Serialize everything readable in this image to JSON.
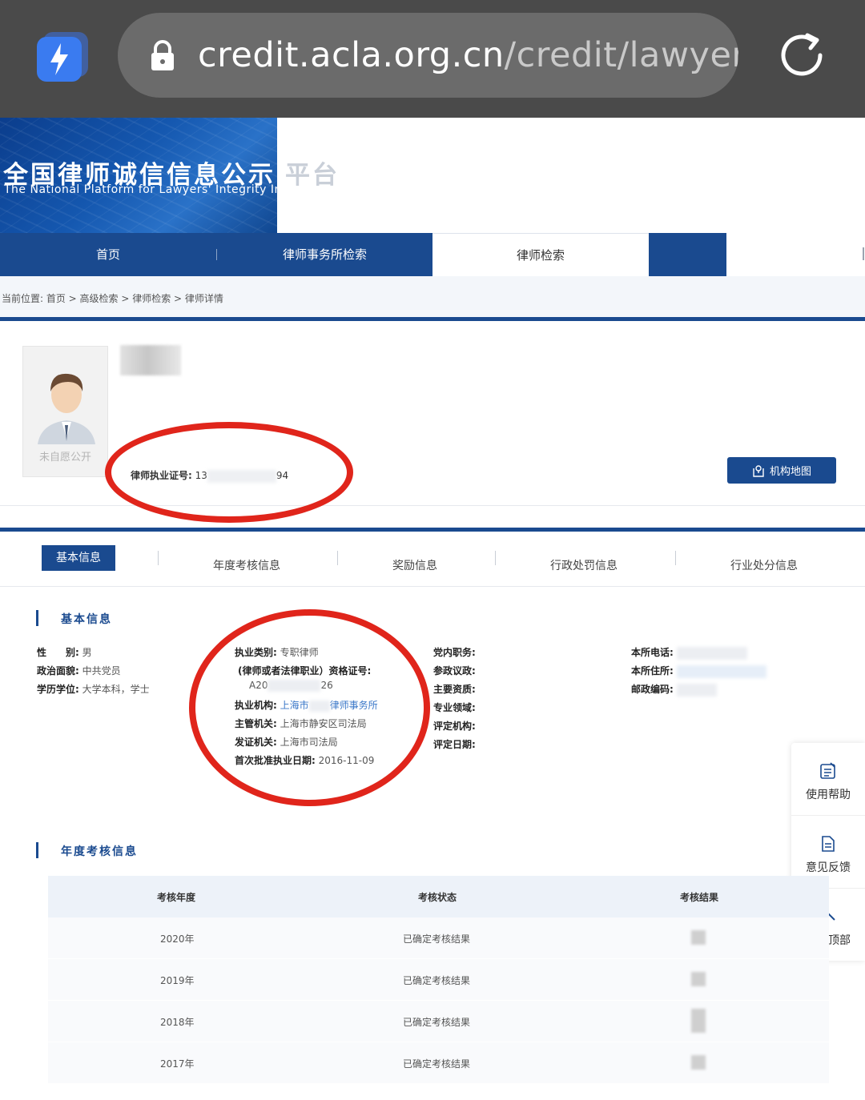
{
  "browser": {
    "url_host": "credit.acla.org.cn",
    "url_path": "/credit/lawyer/"
  },
  "banner": {
    "title": "全国律师诚信信息公示",
    "title_faded": "平台",
    "subtitle": "The National Platform for Lawyers' Integrity In"
  },
  "nav": {
    "items": [
      "首页",
      "律师事务所检索",
      "律师检索"
    ]
  },
  "breadcrumb": {
    "text": "当前位置:  首页 > 高级检索 > 律师检索 > 律师详情"
  },
  "profile": {
    "avatar_note": "未自愿公开",
    "license_label": "律师执业证号:",
    "license_prefix": "13",
    "license_suffix": "94",
    "map_button": "机构地图"
  },
  "tabs": [
    "基本信息",
    "年度考核信息",
    "奖励信息",
    "行政处罚信息",
    "行业处分信息"
  ],
  "basic_section": {
    "title": "基本信息",
    "col1": [
      {
        "label": "性　　别:",
        "value": "男"
      },
      {
        "label": "政治面貌:",
        "value": "中共党员"
      },
      {
        "label": "学历学位:",
        "value": "大学本科，学士"
      }
    ],
    "practice_type_label": "执业类别:",
    "practice_type_value": "专职律师",
    "cert_label": "(律师或者法律职业）资格证号:",
    "cert_prefix": "A20",
    "cert_suffix": "26",
    "institution_label": "执业机构:",
    "institution_prefix": "上海市",
    "institution_suffix": "律师事务所",
    "authority_label": "主管机关:",
    "authority_value": "上海市静安区司法局",
    "issuer_label": "发证机关:",
    "issuer_value": "上海市司法局",
    "first_date_label": "首次批准执业日期:",
    "first_date_value": "2016-11-09",
    "col3": [
      "党内职务:",
      "参政议政:",
      "主要资质:",
      "专业领域:",
      "评定机构:",
      "评定日期:"
    ],
    "col4": [
      "本所电话:",
      "本所住所:",
      "邮政编码:"
    ]
  },
  "side": [
    "使用帮助",
    "意见反馈",
    "返回顶部"
  ],
  "annual_section": {
    "title": "年度考核信息",
    "headers": [
      "考核年度",
      "考核状态",
      "考核结果"
    ],
    "rows": [
      {
        "year": "2020年",
        "status": "已确定考核结果"
      },
      {
        "year": "2019年",
        "status": "已确定考核结果"
      },
      {
        "year": "2018年",
        "status": "已确定考核结果"
      },
      {
        "year": "2017年",
        "status": "已确定考核结果"
      }
    ]
  }
}
